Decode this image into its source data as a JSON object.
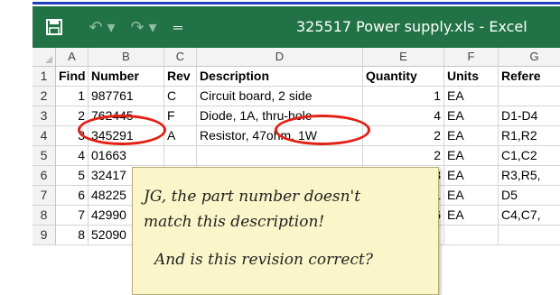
{
  "titlebar": {
    "title": "325517 Power supply.xls  -  Excel",
    "save_icon": "save-icon",
    "undo_icon": "undo-icon",
    "redo_icon": "redo-icon",
    "qat_icon": "customize-quick-access-icon",
    "background_color": "#217346"
  },
  "columns": [
    "A",
    "B",
    "C",
    "D",
    "E",
    "F",
    "G"
  ],
  "rows": [
    {
      "num": "1",
      "find": "Find",
      "number": "Number",
      "rev": "Rev",
      "description": "Description",
      "quantity": "Quantity",
      "units": "Units",
      "reference": "Refere"
    },
    {
      "num": "2",
      "find": "1",
      "number": "987761",
      "rev": "C",
      "description": "Circuit board, 2 side",
      "quantity": "1",
      "units": "EA",
      "reference": ""
    },
    {
      "num": "3",
      "find": "2",
      "number": "762445",
      "rev": "F",
      "description": "Diode, 1A, thru-hole",
      "quantity": "4",
      "units": "EA",
      "reference": "D1-D4"
    },
    {
      "num": "4",
      "find": "3",
      "number": "345291",
      "rev": "A",
      "description": "Resistor, 47ohm, 1W",
      "quantity": "2",
      "units": "EA",
      "reference": "R1,R2"
    },
    {
      "num": "5",
      "find": "4",
      "number": "01663",
      "rev": "",
      "description": "",
      "quantity": "2",
      "units": "EA",
      "reference": "C1,C2"
    },
    {
      "num": "6",
      "find": "5",
      "number": "32417",
      "rev": "",
      "description": "",
      "quantity": "3",
      "units": "EA",
      "reference": "R3,R5,"
    },
    {
      "num": "7",
      "find": "6",
      "number": "48225",
      "rev": "",
      "description": "",
      "quantity": "1",
      "units": "EA",
      "reference": "D5"
    },
    {
      "num": "8",
      "find": "7",
      "number": "42990",
      "rev": "",
      "description": "",
      "quantity": "6",
      "units": "EA",
      "reference": "C4,C7,"
    },
    {
      "num": "9",
      "find": "8",
      "number": "52090",
      "rev": "",
      "description": "",
      "quantity": "",
      "units": "",
      "reference": ""
    }
  ],
  "note": {
    "line1": "JG, the part number doesn't",
    "line2": "match this description!",
    "line3": "And is this revision correct?"
  },
  "annotation_color": "#e32012"
}
